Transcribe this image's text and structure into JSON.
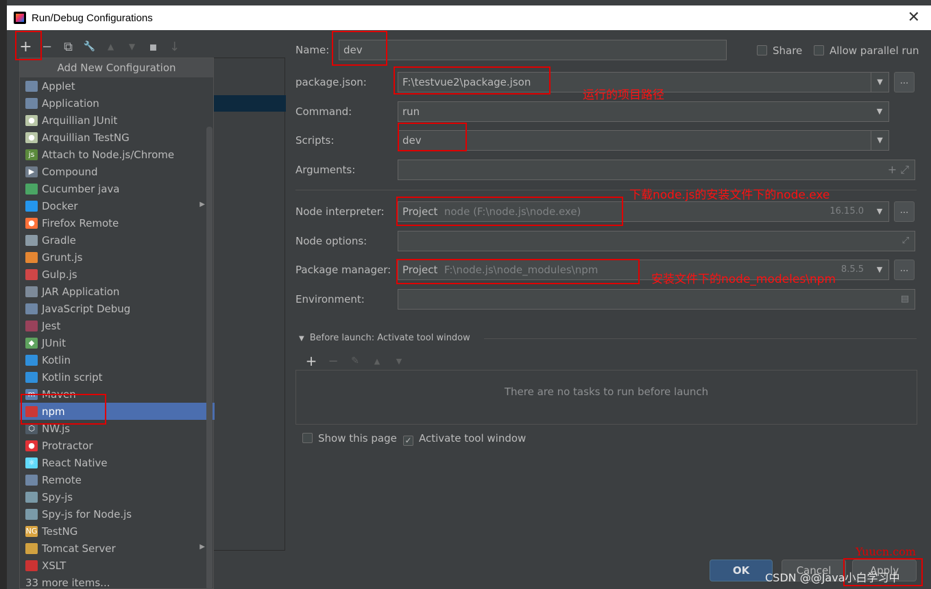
{
  "window": {
    "title": "Run/Debug Configurations",
    "close": "✕"
  },
  "toolbar": {
    "add": "+",
    "remove": "−",
    "copy": "⧉",
    "edit": "🔧",
    "up": "▲",
    "down": "▼",
    "folder": "▪",
    "sort": "↓"
  },
  "popup": {
    "header": "Add New Configuration",
    "items": [
      {
        "label": "Applet",
        "icon": "applet-icon",
        "color": "#6e86a4",
        "glyph": ""
      },
      {
        "label": "Application",
        "icon": "application-icon",
        "color": "#6e86a4",
        "glyph": ""
      },
      {
        "label": "Arquillian JUnit",
        "icon": "alien-icon",
        "color": "#b8c6a6",
        "glyph": "●"
      },
      {
        "label": "Arquillian TestNG",
        "icon": "alien-icon",
        "color": "#b8c6a6",
        "glyph": "●"
      },
      {
        "label": "Attach to Node.js/Chrome",
        "icon": "nodejs-attach-icon",
        "color": "#5b8a3c",
        "glyph": "js"
      },
      {
        "label": "Compound",
        "icon": "compound-icon",
        "color": "#6e7b8a",
        "glyph": "▶"
      },
      {
        "label": "Cucumber java",
        "icon": "cucumber-icon",
        "color": "#4aa564",
        "glyph": ""
      },
      {
        "label": "Docker",
        "icon": "docker-icon",
        "color": "#2496ed",
        "glyph": "",
        "submenu": true
      },
      {
        "label": "Firefox Remote",
        "icon": "firefox-icon",
        "color": "#ff7139",
        "glyph": "●"
      },
      {
        "label": "Gradle",
        "icon": "gradle-icon",
        "color": "#8a9aa5",
        "glyph": ""
      },
      {
        "label": "Grunt.js",
        "icon": "grunt-icon",
        "color": "#e48632",
        "glyph": ""
      },
      {
        "label": "Gulp.js",
        "icon": "gulp-icon",
        "color": "#cf4647",
        "glyph": ""
      },
      {
        "label": "JAR Application",
        "icon": "jar-icon",
        "color": "#7d8a99",
        "glyph": ""
      },
      {
        "label": "JavaScript Debug",
        "icon": "js-debug-icon",
        "color": "#6e86a4",
        "glyph": ""
      },
      {
        "label": "Jest",
        "icon": "jest-icon",
        "color": "#99425b",
        "glyph": ""
      },
      {
        "label": "JUnit",
        "icon": "junit-icon",
        "color": "#5fa35f",
        "glyph": "◆"
      },
      {
        "label": "Kotlin",
        "icon": "kotlin-icon",
        "color": "#2f8fdb",
        "glyph": ""
      },
      {
        "label": "Kotlin script",
        "icon": "kotlin-script-icon",
        "color": "#2f8fdb",
        "glyph": ""
      },
      {
        "label": "Maven",
        "icon": "maven-icon",
        "color": "#5a7fb0",
        "glyph": "m"
      },
      {
        "label": "npm",
        "icon": "npm-icon",
        "color": "#cb3837",
        "glyph": ""
      },
      {
        "label": "NW.js",
        "icon": "nwjs-icon",
        "color": "#4f5b66",
        "glyph": "⬡"
      },
      {
        "label": "Protractor",
        "icon": "protractor-icon",
        "color": "#e23237",
        "glyph": "●"
      },
      {
        "label": "React Native",
        "icon": "react-icon",
        "color": "#61dafb",
        "glyph": "⚛"
      },
      {
        "label": "Remote",
        "icon": "remote-icon",
        "color": "#6e86a4",
        "glyph": ""
      },
      {
        "label": "Spy-js",
        "icon": "spy-js-icon",
        "color": "#7a9aa8",
        "glyph": ""
      },
      {
        "label": "Spy-js for Node.js",
        "icon": "spy-js-node-icon",
        "color": "#7a9aa8",
        "glyph": ""
      },
      {
        "label": "TestNG",
        "icon": "testng-icon",
        "color": "#d9a441",
        "glyph": "NG"
      },
      {
        "label": "Tomcat Server",
        "icon": "tomcat-icon",
        "color": "#d1a140",
        "glyph": "",
        "submenu": true
      },
      {
        "label": "XSLT",
        "icon": "xslt-icon",
        "color": "#cc3333",
        "glyph": ""
      },
      {
        "label": "33 more items...",
        "icon": "",
        "color": "",
        "glyph": ""
      }
    ],
    "selected_index": 19
  },
  "form": {
    "name_label": "Name:",
    "name_value": "dev",
    "share_label": "Share",
    "parallel_label": "Allow parallel run",
    "package_label": "package.json:",
    "package_value": "F:\\testvue2\\package.json",
    "command_label": "Command:",
    "command_value": "run",
    "scripts_label": "Scripts:",
    "scripts_value": "dev",
    "arguments_label": "Arguments:",
    "node_label": "Node interpreter:",
    "node_prefix": "Project",
    "node_path": "node (F:\\node.js\\node.exe)",
    "node_version": "16.15.0",
    "options_label": "Node options:",
    "pm_label": "Package manager:",
    "pm_prefix": "Project",
    "pm_path": "F:\\node.js\\node_modules\\npm",
    "pm_version": "8.5.5",
    "env_label": "Environment:",
    "browse": "..."
  },
  "before_launch": {
    "title": "Before launch: Activate tool window",
    "empty": "There are no tasks to run before launch",
    "show_page": "Show this page",
    "activate": "Activate tool window"
  },
  "buttons": {
    "ok": "OK",
    "cancel": "Cancel",
    "apply": "Apply"
  },
  "annotations": {
    "project_path": "运行的项目路径",
    "node_exe": "下载node.js的安装文件下的node.exe",
    "npm_path": "安装文件下的node_modeles\\npm"
  },
  "watermarks": {
    "site": "Yuucn.com",
    "csdn": "CSDN @@Java小白学习中"
  }
}
